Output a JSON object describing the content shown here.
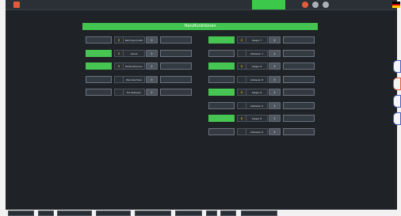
{
  "top": {
    "title": "",
    "status_button": "",
    "user_text": "",
    "right_glyph": ""
  },
  "header": {
    "title": "Handfunktionen"
  },
  "left_rows": [
    {
      "left": "",
      "ctrl": "‹",
      "label": "Kehrlogomulde",
      "arrow": "›",
      "right": "",
      "state_on": false
    },
    {
      "left": "",
      "ctrl": "‹",
      "label": "Lanze",
      "arrow": "›",
      "right": "",
      "state_on": true
    },
    {
      "left": "",
      "ctrl": "‹",
      "label": "Radfunktionen",
      "arrow": "›",
      "right": "",
      "state_on": true
    },
    {
      "left": "",
      "ctrl": "",
      "label": "Wendeschale",
      "arrow": "›",
      "right": "",
      "state_on": false
    },
    {
      "left": "",
      "ctrl": "",
      "label": "Tof ablassen",
      "arrow": "›",
      "right": "",
      "state_on": false
    }
  ],
  "right_rows": [
    {
      "left": "",
      "ctrl": "‹",
      "label": "Sieger 7",
      "arrow": "›",
      "right": "",
      "state_on": true
    },
    {
      "left": "",
      "ctrl": "",
      "label": "Ablassen 7",
      "arrow": "›",
      "right": "",
      "state_on": false
    },
    {
      "left": "",
      "ctrl": "‹",
      "label": "Sieger 8",
      "arrow": "›",
      "right": "",
      "state_on": true
    },
    {
      "left": "",
      "ctrl": "",
      "label": "Ablassen 8",
      "arrow": "›",
      "right": "",
      "state_on": false
    },
    {
      "left": "",
      "ctrl": "‹",
      "label": "Sieger 9",
      "arrow": "›",
      "right": "",
      "state_on": true
    },
    {
      "left": "",
      "ctrl": "",
      "label": "Ablassen 9",
      "arrow": "›",
      "right": "",
      "state_on": false
    },
    {
      "left": "",
      "ctrl": "‹",
      "label": "Sieger 6",
      "arrow": "›",
      "right": "",
      "state_on": true
    },
    {
      "left": "",
      "ctrl": "",
      "label": "Ablassen 6",
      "arrow": "›",
      "right": "",
      "state_on": false
    }
  ],
  "side_tabs": [
    {
      "glyph": ""
    },
    {
      "glyph": ""
    },
    {
      "glyph": ""
    },
    {
      "glyph": ""
    }
  ],
  "bottom": [
    {
      "label": ""
    },
    {
      "label": ""
    },
    {
      "label": ""
    },
    {
      "label": ""
    },
    {
      "label": ""
    },
    {
      "label": ""
    },
    {
      "label": ""
    },
    {
      "label": ""
    },
    {
      "label": ""
    }
  ],
  "colors": {
    "accent_green": "#47c553",
    "header_green": "#42c64f",
    "chevron_yellow": "#f2c200",
    "panel_bg": "#1f2328",
    "button_bg": "#343a42",
    "side_blue": "#4a5dbd",
    "side_red": "#e35a3c"
  },
  "icons": {
    "left_chevron": "chevron-left-icon",
    "right_arrow": "chevron-right-icon"
  }
}
